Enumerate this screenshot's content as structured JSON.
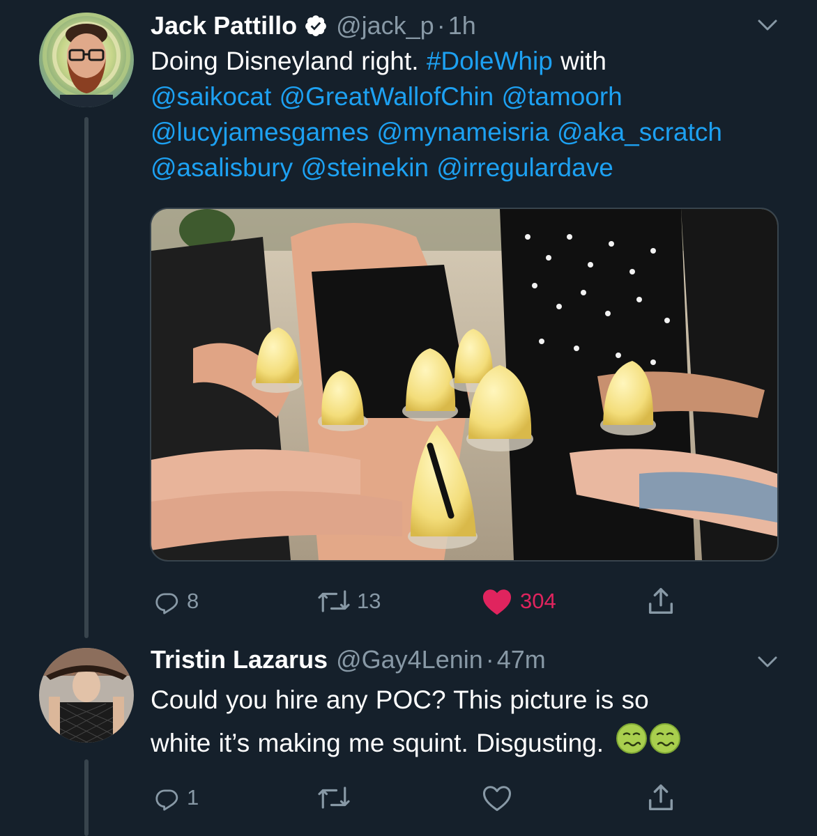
{
  "tweet1": {
    "display_name": "Jack Pattillo",
    "handle": "@jack_p",
    "separator": "·",
    "time": "1h",
    "text_line1_a": "Doing Disneyland right. ",
    "hashtag": "#DoleWhip",
    "text_line1_b": " with",
    "mentions_line2": "@saikocat @GreatWallofChin @tamoorh",
    "mentions_line3": "@lucyjamesgames @mynameisria @aka_scratch",
    "mentions_line4": "@asalisbury @steinekin @irregulardave",
    "reply_count": "8",
    "retweet_count": "13",
    "like_count": "304",
    "liked": true
  },
  "tweet2": {
    "display_name": "Tristin Lazarus",
    "handle": "@Gay4Lenin",
    "separator": "·",
    "time": "47m",
    "text_line1": "Could you hire any POC? This picture is so",
    "text_line2": "white it’s making me squint. Disgusting.",
    "reply_count": "1"
  },
  "colors": {
    "background": "#15202b",
    "secondary_text": "#8899a6",
    "link": "#1da1f2",
    "like": "#e0245e",
    "thread_line": "#38444d"
  },
  "icons": [
    "verified-badge-icon",
    "chevron-down-icon",
    "reply-icon",
    "retweet-icon",
    "heart-icon",
    "share-icon",
    "nauseated-face-emoji"
  ]
}
